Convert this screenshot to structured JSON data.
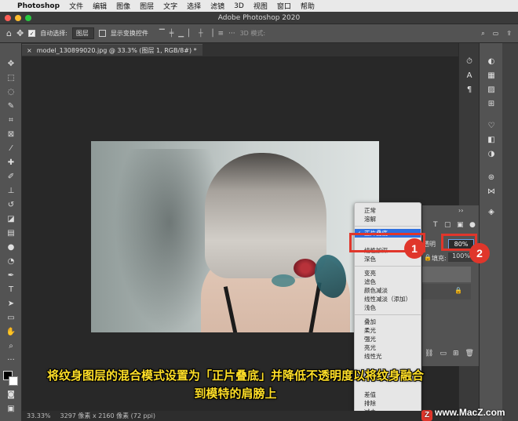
{
  "menubar": {
    "apple_icon": "apple-icon",
    "app_name": "Photoshop",
    "items": [
      "文件",
      "编辑",
      "图像",
      "图层",
      "文字",
      "选择",
      "滤镜",
      "3D",
      "视图",
      "窗口",
      "帮助"
    ]
  },
  "window": {
    "title": "Adobe Photoshop 2020"
  },
  "options_bar": {
    "auto_select_label": "自动选择:",
    "auto_select_value": "图层",
    "show_transform_label": "显示变换控件",
    "mode_3d_label": "3D 模式:"
  },
  "document": {
    "tab_title": "model_130899020.jpg @ 33.3% (图层 1, RGB/8#) *"
  },
  "blend_dropdown": {
    "items_group1": [
      "正常",
      "溶解"
    ],
    "selected": "正片叠底",
    "items_group2": [
      "线性加深",
      "深色"
    ],
    "items_group3": [
      "变亮",
      "滤色",
      "颜色减淡",
      "线性减淡（添加）",
      "浅色"
    ],
    "items_group4": [
      "叠加",
      "柔光",
      "强光",
      "亮光",
      "线性光"
    ],
    "items_group5": [
      "差值",
      "排除",
      "减去"
    ]
  },
  "layers_panel": {
    "opacity_label": "透明",
    "opacity_value": "80%",
    "fill_label": "填充:",
    "fill_value": "100%"
  },
  "annotations": {
    "badge1": "1",
    "badge2": "2"
  },
  "caption": {
    "line1": "将纹身图层的混合模式设置为「正片叠底」并降低不透明度以将纹身融合",
    "line2": "到模特的肩膀上"
  },
  "status_bar": {
    "zoom": "33.33%",
    "doc_info": "3297 像素 x 2160 像素 (72 ppi)"
  },
  "watermark": {
    "text": "www.MacZ.com"
  },
  "colors": {
    "highlight": "#e0362b",
    "caption": "#ffdf27",
    "selection": "#2d6fe0"
  }
}
